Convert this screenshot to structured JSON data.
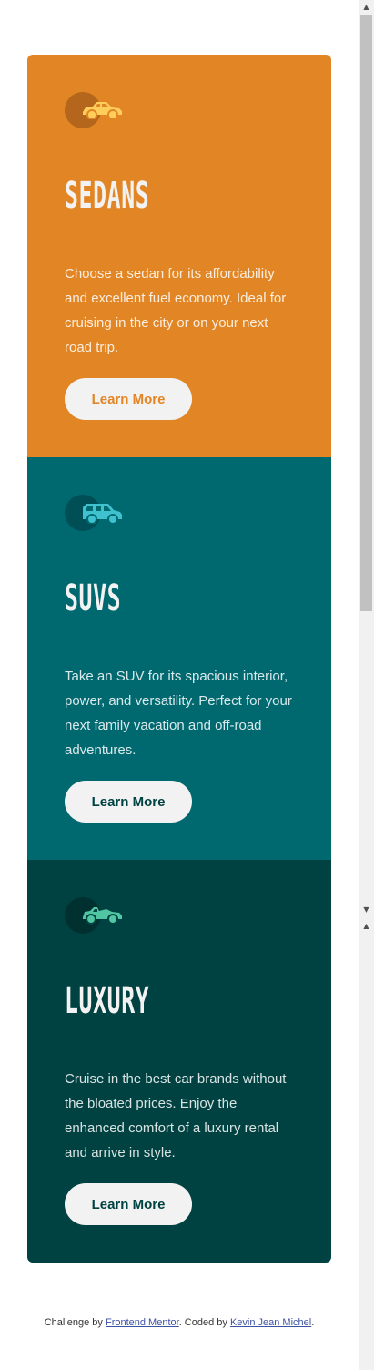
{
  "cards": [
    {
      "title": "SEDANS",
      "text": "Choose a sedan for its affordability and excellent fuel economy. Ideal for cruising in the city or on your next road trip.",
      "button": "Learn More",
      "icon": "sedan-car-icon",
      "color": "#e28625"
    },
    {
      "title": "SUVS",
      "text": "Take an SUV for its spacious interior, power, and versatility. Perfect for your next family vacation and off-road adventures.",
      "button": "Learn More",
      "icon": "suv-car-icon",
      "color": "#006970"
    },
    {
      "title": "LUXURY",
      "text": "Cruise in the best car brands without the bloated prices. Enjoy the enhanced comfort of a luxury rental and arrive in style.",
      "button": "Learn More",
      "icon": "luxury-car-icon",
      "color": "#004241"
    }
  ],
  "footer": {
    "prefix": "Challenge by ",
    "link1": "Frontend Mentor",
    "middle": ". Coded by ",
    "link2": "Kevin Jean Michel",
    "suffix": "."
  },
  "scrollbar": {
    "up_arrow": "▲",
    "down_arrow": "▼"
  }
}
